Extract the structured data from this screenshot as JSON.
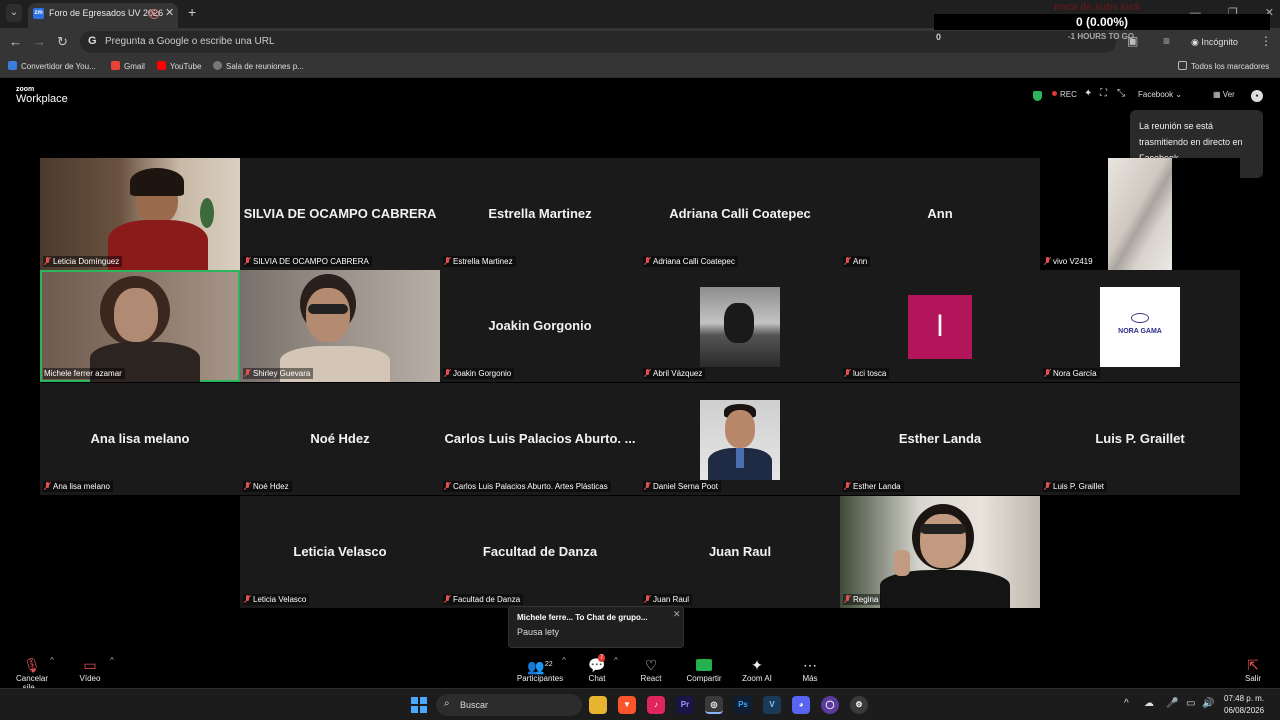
{
  "browser": {
    "tab_title": "Foro de Egresados UV 2026",
    "tab_favicon": "zm",
    "omnibox_placeholder": "Pregunta a Google o escribe una URL",
    "incognito_label": "Incógnito",
    "bookmarks": [
      {
        "label": "Convertidor de You...",
        "color": "#3b7ddd"
      },
      {
        "label": "Gmail",
        "color": "#ea4335"
      },
      {
        "label": "YouTube",
        "color": "#ff0000"
      },
      {
        "label": "Sala de reuniones p...",
        "color": "#777777"
      }
    ],
    "all_bookmarks": "Todos los marcadores"
  },
  "stream_overlay": {
    "label": "meta de subs kick",
    "count": "0 (0.00%)",
    "left_value": "0",
    "hours_text": "-1 HOURS TO GO"
  },
  "zoom": {
    "logo_small": "zoom",
    "logo_big": "Workplace",
    "rec_label": "REC",
    "facebook_label": "Facebook",
    "view_label": "Ver",
    "tooltip": "La reunión se está trasmitiendo en directo en Facebook",
    "tiles": [
      {
        "name": "Leticia Domínguez",
        "big": "",
        "kind": "video-warm"
      },
      {
        "name": "SILVIA DE OCAMPO CABRERA",
        "big": "SILVIA DE OCAMPO CABRERA",
        "kind": "text"
      },
      {
        "name": "Estrella Martinez",
        "big": "Estrella Martinez",
        "kind": "text"
      },
      {
        "name": "Adriana Calli Coatepec",
        "big": "Adriana Calli Coatepec",
        "kind": "text"
      },
      {
        "name": "Ann",
        "big": "Ann",
        "kind": "text"
      },
      {
        "name": "vivo V2419",
        "big": "",
        "kind": "video-wall"
      },
      {
        "name": "Michele ferrer azamar",
        "big": "",
        "kind": "video-cam",
        "selected": true
      },
      {
        "name": "Shirley Guevara",
        "big": "",
        "kind": "video-cam2"
      },
      {
        "name": "Joakin Gorgonio",
        "big": "Joakin Gorgonio",
        "kind": "text"
      },
      {
        "name": "Abril Vázquez",
        "big": "",
        "kind": "photo-bw"
      },
      {
        "name": "luci tosca",
        "big": "",
        "kind": "initial",
        "initial": "l"
      },
      {
        "name": "Nora García",
        "big": "",
        "kind": "logo",
        "logo_text": "NORA GAMA"
      },
      {
        "name": "Ana lisa melano",
        "big": "Ana lisa melano",
        "kind": "text"
      },
      {
        "name": "Noé Hdez",
        "big": "Noé Hdez",
        "kind": "text"
      },
      {
        "name": "Carlos Luis Palacios Aburto. Artes Plásticas",
        "big": "Carlos Luis Palacios Aburto. ...",
        "kind": "text"
      },
      {
        "name": "Daniel Serna Poot",
        "big": "",
        "kind": "photo-man"
      },
      {
        "name": "Esther Landa",
        "big": "Esther Landa",
        "kind": "text"
      },
      {
        "name": "Luis P. Graillet",
        "big": "Luis P. Graillet",
        "kind": "text"
      },
      {
        "name": "Leticia Velasco",
        "big": "Leticia Velasco",
        "kind": "text"
      },
      {
        "name": "Facultad de Danza",
        "big": "Facultad de Danza",
        "kind": "text"
      },
      {
        "name": "Juan Raul",
        "big": "Juan Raul",
        "kind": "text"
      },
      {
        "name": "Regina",
        "big": "",
        "kind": "video-regina"
      }
    ],
    "chat_toast": {
      "title": "Michele ferre... To Chat de grupo...",
      "body": "Pausa lety"
    },
    "controls": {
      "mute": "Cancelar sile...",
      "video": "Vídeo",
      "participants": "Participantes",
      "participants_count": "22",
      "chat": "Chat",
      "chat_badge": "7",
      "react": "React",
      "share": "Compartir",
      "ai": "Zoom AI",
      "more": "Más",
      "leave": "Salir"
    }
  },
  "taskbar": {
    "search_placeholder": "Buscar",
    "time": "07:48 p. m.",
    "date": "06/08/2026"
  }
}
